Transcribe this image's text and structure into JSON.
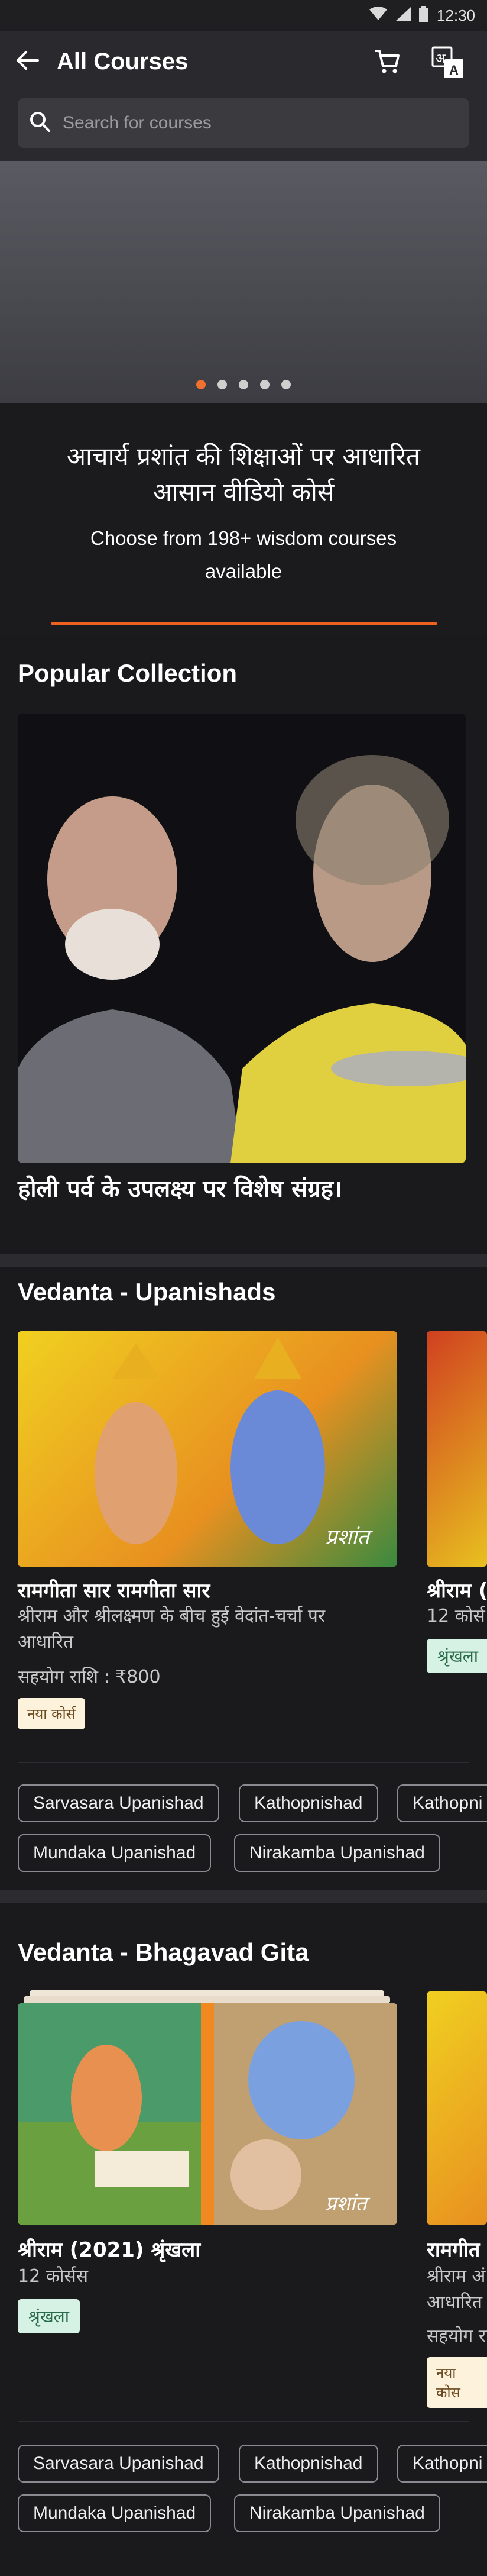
{
  "status_bar": {
    "time": "12:30"
  },
  "header": {
    "title": "All Courses",
    "search_placeholder": "Search for courses"
  },
  "banner": {
    "dots": 5,
    "active_dot": 0
  },
  "intro": {
    "hindi": "आचार्य प्रशांत की शिक्षाओं पर आधारित आसान वीडियो कोर्स",
    "english": "Choose from 198+ wisdom courses available"
  },
  "popular": {
    "heading": "Popular Collection",
    "caption": "होली पर्व के उपलक्ष्य पर विशेष संग्रह।"
  },
  "vedanta_upanishads": {
    "heading": "Vedanta - Upanishads",
    "card1": {
      "title": "रामगीता सार रामगीता सार",
      "subtitle": "श्रीराम और श्रीलक्ष्मण के बीच हुई वेदांत-चर्चा पर आधारित",
      "price": "सहयोग राशि : ₹800",
      "badge": "नया कोर्स"
    },
    "card2": {
      "title": "श्रीराम (",
      "count": "12 कोर्स",
      "badge": "श्रृंखला"
    },
    "chips": [
      "Sarvasara Upanishad",
      "Kathopnishad",
      "Kathopni",
      "Mundaka Upanishad",
      "Nirakamba Upanishad"
    ]
  },
  "vedanta_gita": {
    "heading": "Vedanta - Bhagavad Gita",
    "card1": {
      "title": "श्रीराम (2021) श्रृंखला",
      "count": "12 कोर्सस",
      "badge": "श्रृंखला"
    },
    "card2": {
      "title": "रामगीत",
      "subtitle_1": "श्रीराम अं",
      "subtitle_2": "आधारित",
      "price": "सहयोग रा",
      "badge": "नया कोस"
    },
    "chips": [
      "Sarvasara Upanishad",
      "Kathopnishad",
      "Kathopni",
      "Mundaka Upanishad",
      "Nirakamba Upanishad"
    ]
  },
  "colors": {
    "accent": "#f06020",
    "background": "#1a1a1c",
    "appbar": "#2a2a2e"
  }
}
